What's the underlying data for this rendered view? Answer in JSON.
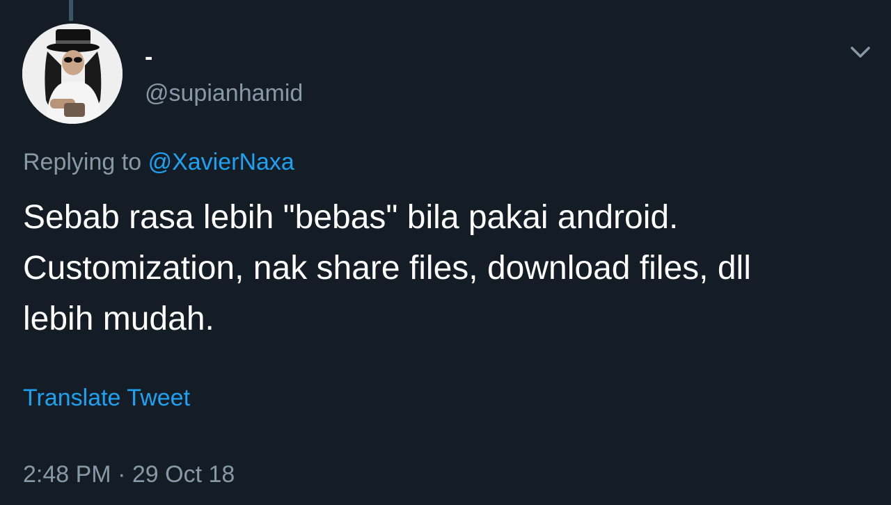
{
  "tweet": {
    "author": {
      "display_name": "-",
      "handle": "@supianhamid"
    },
    "reply": {
      "prefix": "Replying to",
      "mention": "@XavierNaxa"
    },
    "text": "Sebab rasa lebih \"bebas\" bila pakai android.\nCustomization, nak share files, download files, dll\nlebih mudah.",
    "translate_label": "Translate Tweet",
    "time": "2:48 PM",
    "separator": "·",
    "date": "29 Oct 18"
  },
  "icons": {
    "menu": "chevron-down-icon"
  },
  "colors": {
    "background": "#141d26",
    "primary_text": "#ffffff",
    "secondary_text": "#8899a6",
    "accent": "#1da1f2"
  }
}
